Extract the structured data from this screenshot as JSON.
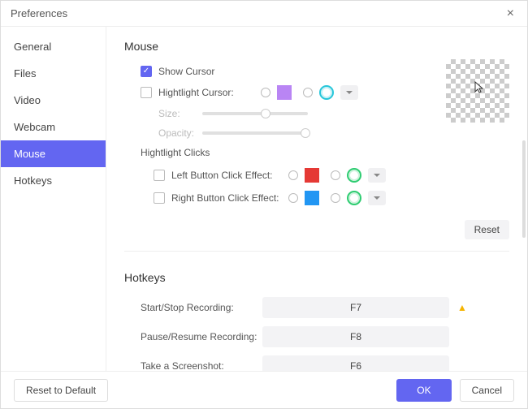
{
  "window": {
    "title": "Preferences"
  },
  "sidebar": {
    "items": [
      {
        "label": "General"
      },
      {
        "label": "Files"
      },
      {
        "label": "Video"
      },
      {
        "label": "Webcam"
      },
      {
        "label": "Mouse"
      },
      {
        "label": "Hotkeys"
      }
    ],
    "active_index": 4
  },
  "mouse": {
    "section_title": "Mouse",
    "show_cursor_label": "Show Cursor",
    "highlight_cursor_label": "Hightlight Cursor:",
    "size_label": "Size:",
    "opacity_label": "Opacity:",
    "highlight_clicks_title": "Hightlight Clicks",
    "left_click_label": "Left Button Click Effect:",
    "right_click_label": "Right Button Click Effect:",
    "reset_label": "Reset",
    "colors": {
      "highlight_cursor_swatch": "#b985f4",
      "left_click_swatch": "#e53935",
      "right_click_swatch": "#2196f3"
    }
  },
  "hotkeys": {
    "section_title": "Hotkeys",
    "rows": [
      {
        "label": "Start/Stop Recording:",
        "key": "F7",
        "warn": true
      },
      {
        "label": "Pause/Resume Recording:",
        "key": "F8",
        "warn": false
      },
      {
        "label": "Take a Screenshot:",
        "key": "F6",
        "warn": false
      }
    ]
  },
  "footer": {
    "reset_default": "Reset to Default",
    "ok": "OK",
    "cancel": "Cancel"
  }
}
